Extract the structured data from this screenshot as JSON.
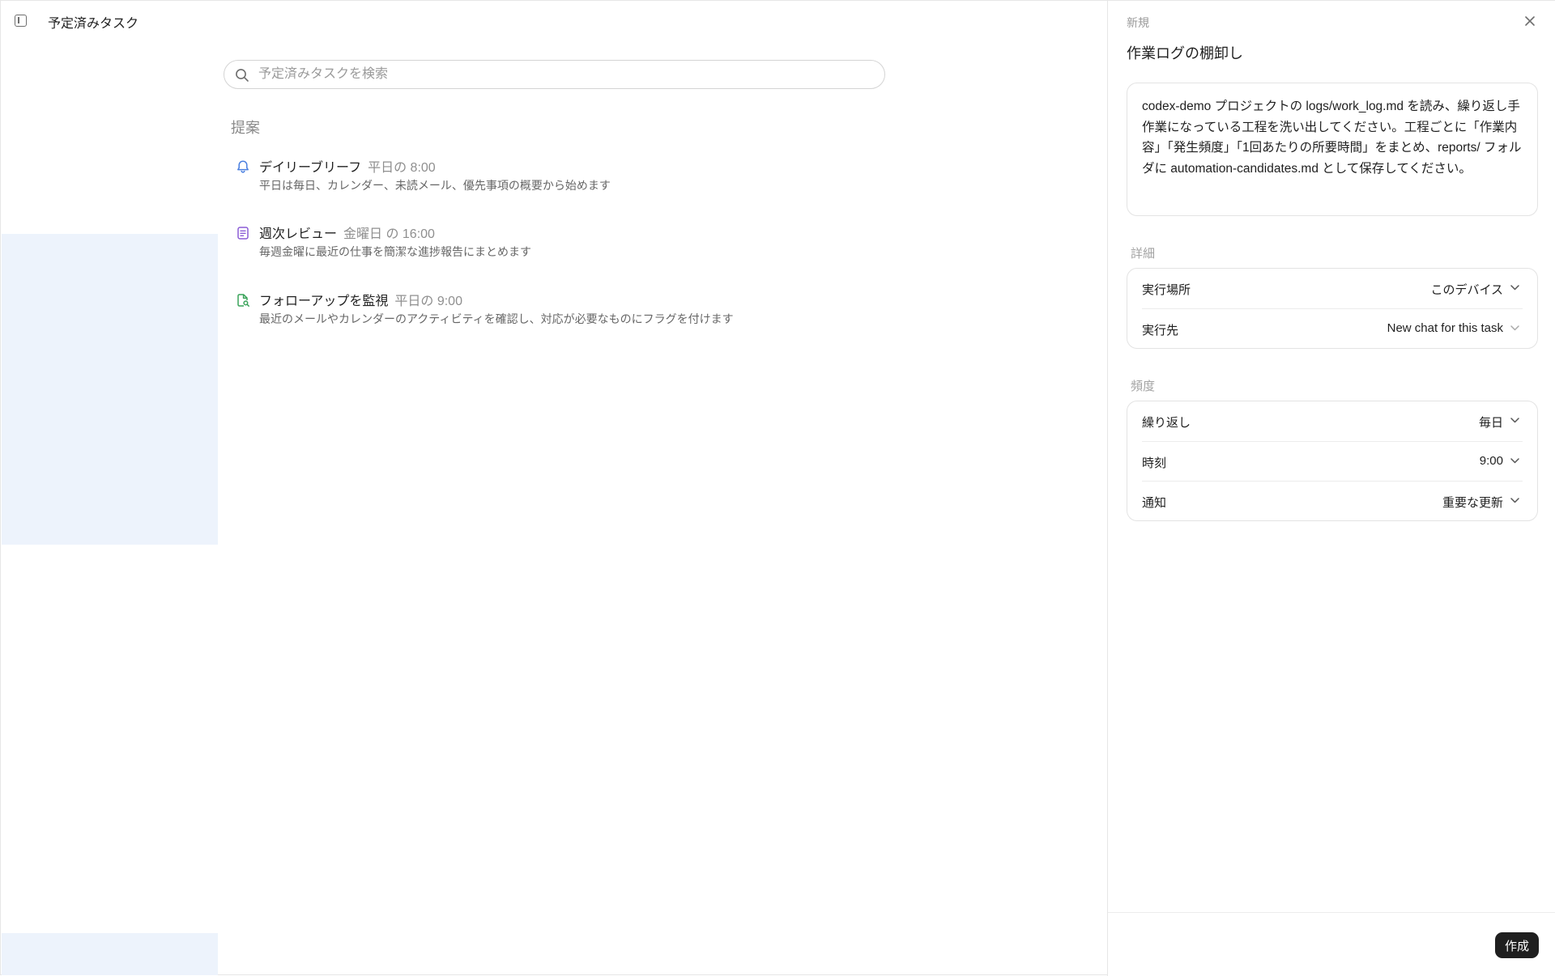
{
  "colors": {
    "accent_dark": "#1f1f1f",
    "selection_tint": "#edf3fc",
    "bell_blue": "#4a7fe0",
    "review_purple": "#8b5cd6",
    "followup_green": "#3aa35a"
  },
  "header": {
    "title": "予定済みタスク",
    "toggle_icon": "sidebar-toggle-icon"
  },
  "search": {
    "placeholder": "予定済みタスクを検索",
    "icon": "search-icon"
  },
  "suggestions": {
    "label": "提案",
    "items": [
      {
        "icon": "bell-icon",
        "name": "デイリーブリーフ",
        "schedule": "平日の 8:00",
        "description": "平日は毎日、カレンダー、未読メール、優先事項の概要から始めます"
      },
      {
        "icon": "document-icon",
        "name": "週次レビュー",
        "schedule": "金曜日 の 16:00",
        "description": "毎週金曜に最近の仕事を簡潔な進捗報告にまとめます"
      },
      {
        "icon": "file-search-icon",
        "name": "フォローアップを監視",
        "schedule": "平日の 9:00",
        "description": "最近のメールやカレンダーのアクティビティを確認し、対応が必要なものにフラグを付けます"
      }
    ]
  },
  "panel": {
    "kicker": "新規",
    "title": "作業ログの棚卸し",
    "close_icon": "close-icon",
    "prompt": "codex-demo プロジェクトの logs/work_log.md を読み、繰り返し手作業になっている工程を洗い出してください。工程ごとに「作業内容」「発生頻度」「1回あたりの所要時間」をまとめ、reports/ フォルダに automation-candidates.md として保存してください。",
    "details": {
      "label": "詳細",
      "rows": [
        {
          "key": "実行場所",
          "value": "このデバイス"
        },
        {
          "key": "実行先",
          "value": "New chat for this task"
        }
      ]
    },
    "frequency": {
      "label": "頻度",
      "rows": [
        {
          "key": "繰り返し",
          "value": "毎日"
        },
        {
          "key": "時刻",
          "value": "9:00"
        },
        {
          "key": "通知",
          "value": "重要な更新"
        }
      ]
    },
    "create_label": "作成"
  }
}
